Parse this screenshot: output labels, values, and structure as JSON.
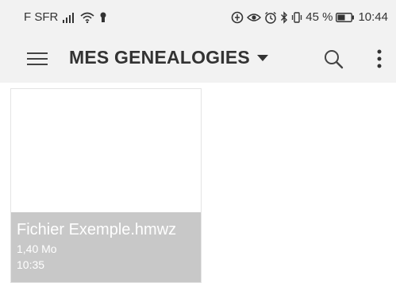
{
  "status_bar": {
    "carrier": "F SFR",
    "battery_percent": "45 %",
    "time": "10:44",
    "icons": [
      "signal-icon",
      "wifi-icon",
      "keyhole-icon",
      "data-saver-icon",
      "eye-icon",
      "alarm-icon",
      "bluetooth-icon",
      "vibrate-icon",
      "battery-icon"
    ]
  },
  "app_bar": {
    "title": "MES GENEALOGIES",
    "icons": [
      "menu-icon",
      "dropdown-arrow-icon",
      "search-icon",
      "more-vert-icon"
    ]
  },
  "files": [
    {
      "name": "Fichier Exemple.hmwz",
      "size": "1,40 Mo",
      "time": "10:35"
    }
  ],
  "colors": {
    "bar_background": "#f2f2f2",
    "card_info_background": "#c8c8c8",
    "text_dark": "#333333"
  }
}
